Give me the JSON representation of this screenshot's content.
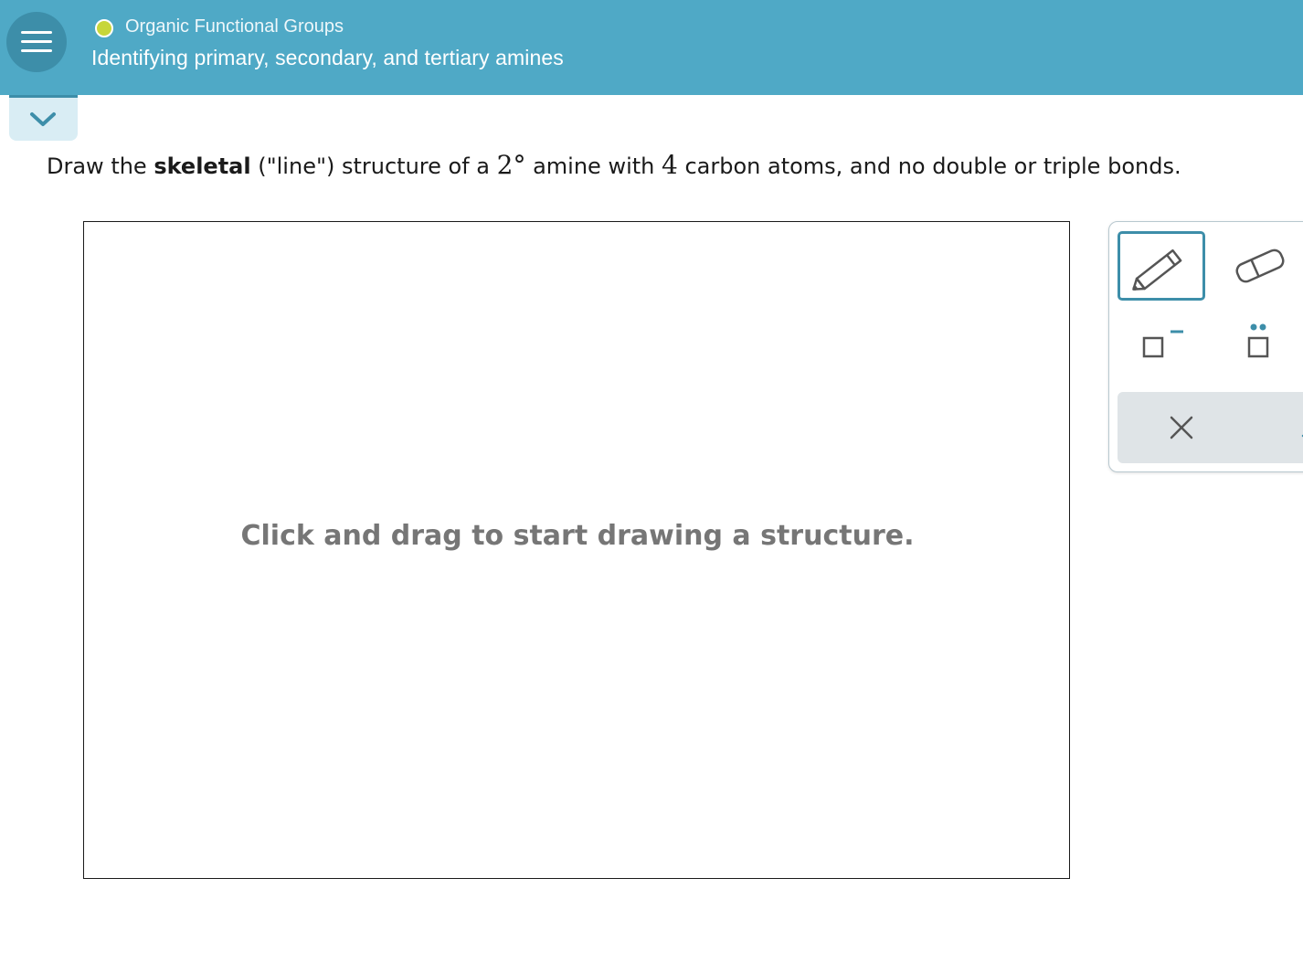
{
  "header": {
    "topic": "Organic Functional Groups",
    "lesson_title": "Identifying primary, secondary, and tertiary amines",
    "topic_status_color": "#c7d63a",
    "bar_color": "#4fa9c6"
  },
  "question": {
    "part1": "Draw the ",
    "bold": "skeletal",
    "part2": " (\"line\") structure of a ",
    "math1": "2°",
    "part3": " amine with ",
    "math2": "4",
    "part4": " carbon atoms, and no double or triple bonds."
  },
  "canvas": {
    "hint": "Click and drag to start drawing a structure."
  },
  "palette": {
    "tools": [
      "pencil-icon",
      "eraser-icon",
      "negative-charge-icon",
      "lone-pair-icon"
    ],
    "actions": [
      "clear-icon",
      "undo-icon"
    ]
  }
}
